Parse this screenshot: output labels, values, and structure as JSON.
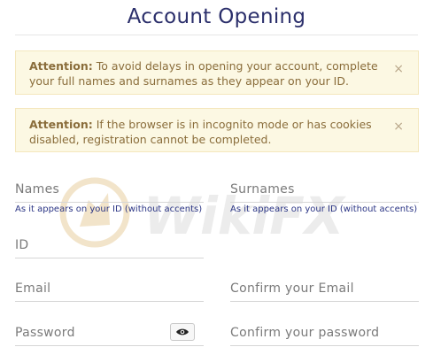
{
  "header": {
    "title": "Account Opening"
  },
  "alerts": [
    {
      "prefix": "Attention:",
      "text": " To avoid delays in opening your account, complete your full names and surnames as they appear on your ID."
    },
    {
      "prefix": "Attention:",
      "text": " If the browser is in incognito mode or has cookies disabled, registration cannot be completed."
    }
  ],
  "alert_close_glyph": "×",
  "form": {
    "names": {
      "label": "Names",
      "helper": "As it appears on your ID (without accents)"
    },
    "surnames": {
      "label": "Surnames",
      "helper": "As it appears on your ID (without accents)"
    },
    "id": {
      "label": "ID"
    },
    "email": {
      "label": "Email"
    },
    "confirm_email": {
      "label": "Confirm your Email"
    },
    "password": {
      "label": "Password"
    },
    "confirm_password": {
      "label": "Confirm your password"
    }
  },
  "watermark": {
    "text": "WikiFX"
  },
  "colors": {
    "title": "#2b2f6b",
    "alert_bg": "#fcf8e3",
    "alert_text": "#8a6d3b",
    "helper": "#2b3585"
  }
}
